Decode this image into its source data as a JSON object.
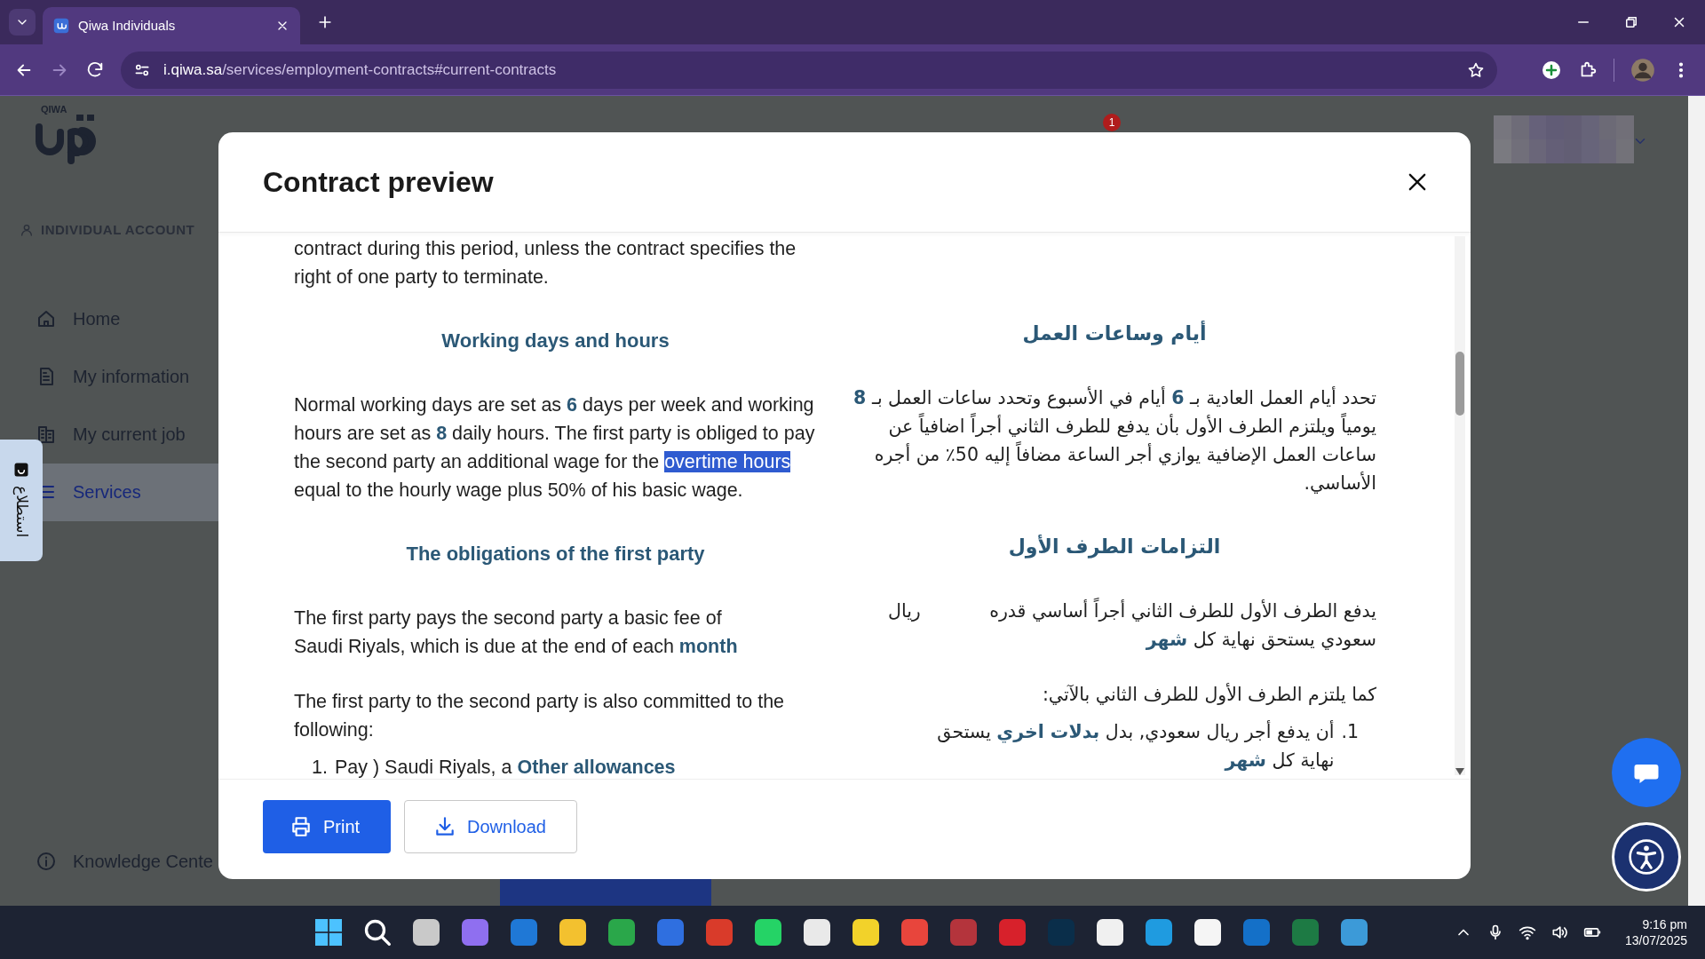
{
  "browser": {
    "tab_title": "Qiwa Individuals",
    "url_host": "i.qiwa.sa",
    "url_path": "/services/employment-contracts#current-contracts"
  },
  "sidebar": {
    "logo_text": "QIWA",
    "account_label": "INDIVIDUAL ACCOUNT",
    "items": [
      {
        "label": "Home",
        "selected": false
      },
      {
        "label": "My information",
        "selected": false
      },
      {
        "label": "My current job",
        "selected": false
      },
      {
        "label": "Services",
        "selected": true
      }
    ],
    "footer_item": "Knowledge Cente"
  },
  "survey_tab": {
    "label": "استطلاع"
  },
  "notification_badge": "1",
  "modal": {
    "title": "Contract preview",
    "english_column": [
      {
        "kind": "paragraph",
        "lines": [
          "contract during this period, unless the contract specifies the right of one party to terminate."
        ]
      },
      {
        "kind": "heading",
        "text": "Working days and hours"
      },
      {
        "kind": "paragraph",
        "segments": [
          {
            "text": "Normal working days are set as **6** days per week and working hours are set as **8** daily hours. The first party is obliged to pay the second party an additional wage for the",
            "selected": false
          },
          {
            "text": "overtime hours",
            "selected": true
          },
          {
            "text": "equal to the hourly wage plus 50% of his basic wage.",
            "selected": false
          }
        ]
      },
      {
        "kind": "heading",
        "text": "The obligations of the first party"
      },
      {
        "kind": "paragraph",
        "lines": [
          "The first party pays the second party a basic fee of",
          "Saudi Riyals, which is due at the end of each **month**"
        ]
      },
      {
        "kind": "paragraph",
        "lines": [
          "The first party to the second party is also committed to the following:"
        ]
      },
      {
        "kind": "list_item",
        "number": "1.",
        "lines": [
          "Pay ) Saudi Riyals, a **Other allowances**"
        ]
      }
    ],
    "arabic_column": [
      {
        "kind": "heading",
        "text": "أيام وساعات العمل"
      },
      {
        "kind": "paragraph",
        "lines": [
          "تحدد أيام العمل العادية بـ **6** أيام في الأسبوع وتحدد ساعات العمل بـ **8** يومياً ويلتزم الطرف الأول بأن يدفع للطرف الثاني أجراً اضافياً عن ساعات العمل الإضافية يوازي أجر الساعة مضافاً إليه 50٪ من أجره الأساسي."
        ]
      },
      {
        "kind": "heading",
        "text": "التزامات الطرف الأول"
      },
      {
        "kind": "paragraph",
        "lines": [
          "يدفع الطرف الأول للطرف الثاني أجراً أساسي قدره",
          "سعودي يستحق نهاية كل **شهر**"
        ],
        "trailing": "ريال"
      },
      {
        "kind": "paragraph",
        "lines": [
          "كما يلتزم الطرف الأول للطرف الثاني بالآتي:"
        ]
      },
      {
        "kind": "list_item",
        "number": "1.",
        "lines": [
          "أن يدفع أجر ريال سعودي, بدل **بدلات اخري** يستحق",
          "نهاية كل **شهر**"
        ]
      }
    ],
    "print_button": "Print",
    "download_button": "Download"
  },
  "taskbar": {
    "time": "9:16 pm",
    "date": "13/07/2025"
  }
}
